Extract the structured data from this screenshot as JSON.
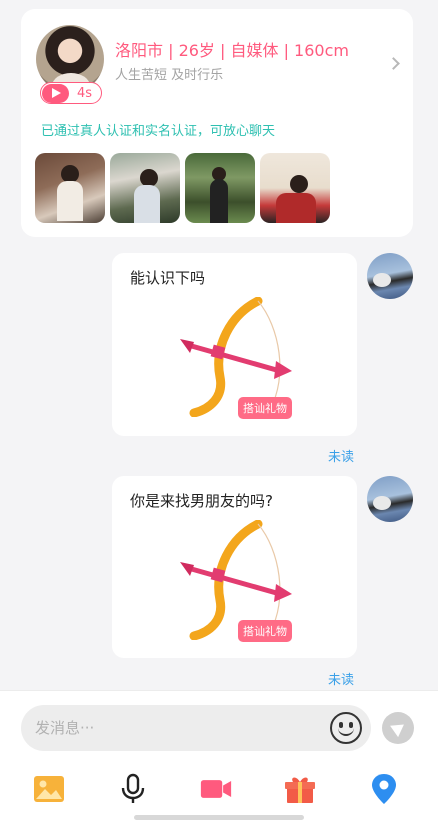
{
  "profile": {
    "info_line": "洛阳市 | 26岁 | 自媒体 | 160cm",
    "motto": "人生苦短 及时行乐",
    "voice_duration": "4s",
    "verify_text": "已通过真人认证和实名认证，可放心聊天",
    "photos": [
      "photo-1",
      "photo-2",
      "photo-3",
      "photo-4"
    ]
  },
  "messages": [
    {
      "text": "能认识下吗",
      "gift_label": "搭讪礼物",
      "status": "未读"
    },
    {
      "text": "你是来找男朋友的吗?",
      "gift_label": "搭讪礼物",
      "status": "未读"
    }
  ],
  "input": {
    "placeholder": "发消息···",
    "value": ""
  },
  "toolbar": [
    "image-icon",
    "microphone-icon",
    "video-camera-icon",
    "gift-icon",
    "location-pin-icon"
  ],
  "colors": {
    "accent_pink": "#ff5a7e",
    "verify_teal": "#2ec0b1",
    "read_status_blue": "#3aa0e8",
    "image_icon": "#f7b23a",
    "video_icon": "#ff5a7e",
    "gift_icon": "#f25b47",
    "location_icon": "#2d8ef0"
  }
}
